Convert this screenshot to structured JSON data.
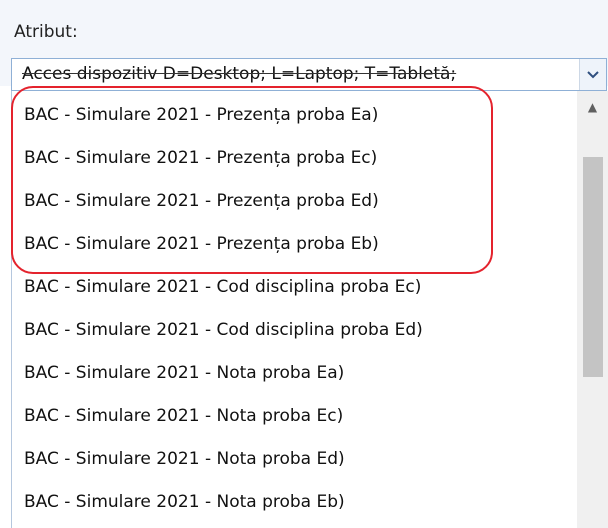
{
  "field": {
    "label": "Atribut:",
    "selected_value": "Acces dispozitiv D=Desktop; L=Laptop; T=Tabletă;",
    "arrow_icon": "chevron-down-icon"
  },
  "dropdown": {
    "options": [
      "BAC - Simulare 2021 - Prezența proba Ea)",
      "BAC - Simulare 2021 - Prezența proba Ec)",
      "BAC - Simulare 2021 - Prezența proba Ed)",
      "BAC - Simulare 2021 - Prezența proba Eb)",
      "BAC - Simulare 2021 - Cod disciplina proba Ec)",
      "BAC - Simulare 2021 - Cod disciplina proba Ed)",
      "BAC - Simulare 2021 - Nota proba Ea)",
      "BAC - Simulare 2021 - Nota proba Ec)",
      "BAC - Simulare 2021 - Nota proba Ed)",
      "BAC - Simulare 2021 - Nota proba Eb)"
    ]
  },
  "annotation": {
    "color": "#e4232d",
    "highlighted_options": 4
  },
  "colors": {
    "header_background": "#f3f6fb",
    "combo_border": "#8fb0d6"
  }
}
